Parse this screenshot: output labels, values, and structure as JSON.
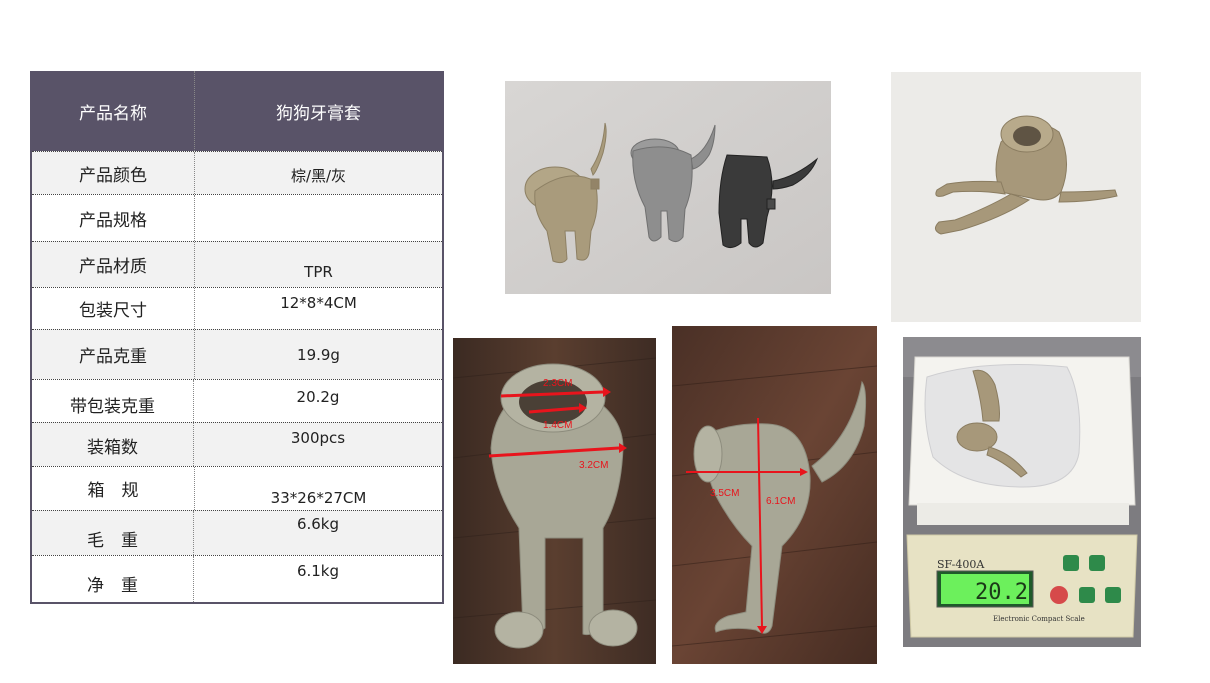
{
  "table": {
    "header": {
      "name_label": "产品名称",
      "name_value": "狗狗牙膏套"
    },
    "rows": [
      {
        "label": "产品颜色",
        "value": "棕/黑/灰"
      },
      {
        "label": "产品规格",
        "value": ""
      },
      {
        "label": "产品材质",
        "value": "TPR"
      },
      {
        "label": "包装尺寸",
        "value": "12*8*4CM"
      },
      {
        "label": "产品克重",
        "value": "19.9g"
      },
      {
        "label": "带包装克重",
        "value": "20.2g"
      },
      {
        "label": "装箱数",
        "value": "300pcs"
      },
      {
        "label": "箱　规",
        "value": "33*26*27CM"
      },
      {
        "label": "毛　重",
        "value": "6.6kg"
      },
      {
        "label": "净　重",
        "value": "6.1kg"
      }
    ]
  },
  "photos": {
    "front_measure": {
      "labels": [
        "2.3CM",
        "1.4CM",
        "3.2CM"
      ]
    },
    "side_measure": {
      "labels": [
        "3.5CM",
        "6.1CM"
      ]
    },
    "scale": {
      "model": "SF-400A",
      "reading": "20.2",
      "brand_text": "Electronic Compact Scale"
    }
  },
  "colors": {
    "header_bg": "#595368",
    "border": "#595368",
    "product_tan": "#a99b7c",
    "product_grey": "#8e8e8e",
    "product_black": "#3a3a3a",
    "measure_red": "#e8141c"
  }
}
